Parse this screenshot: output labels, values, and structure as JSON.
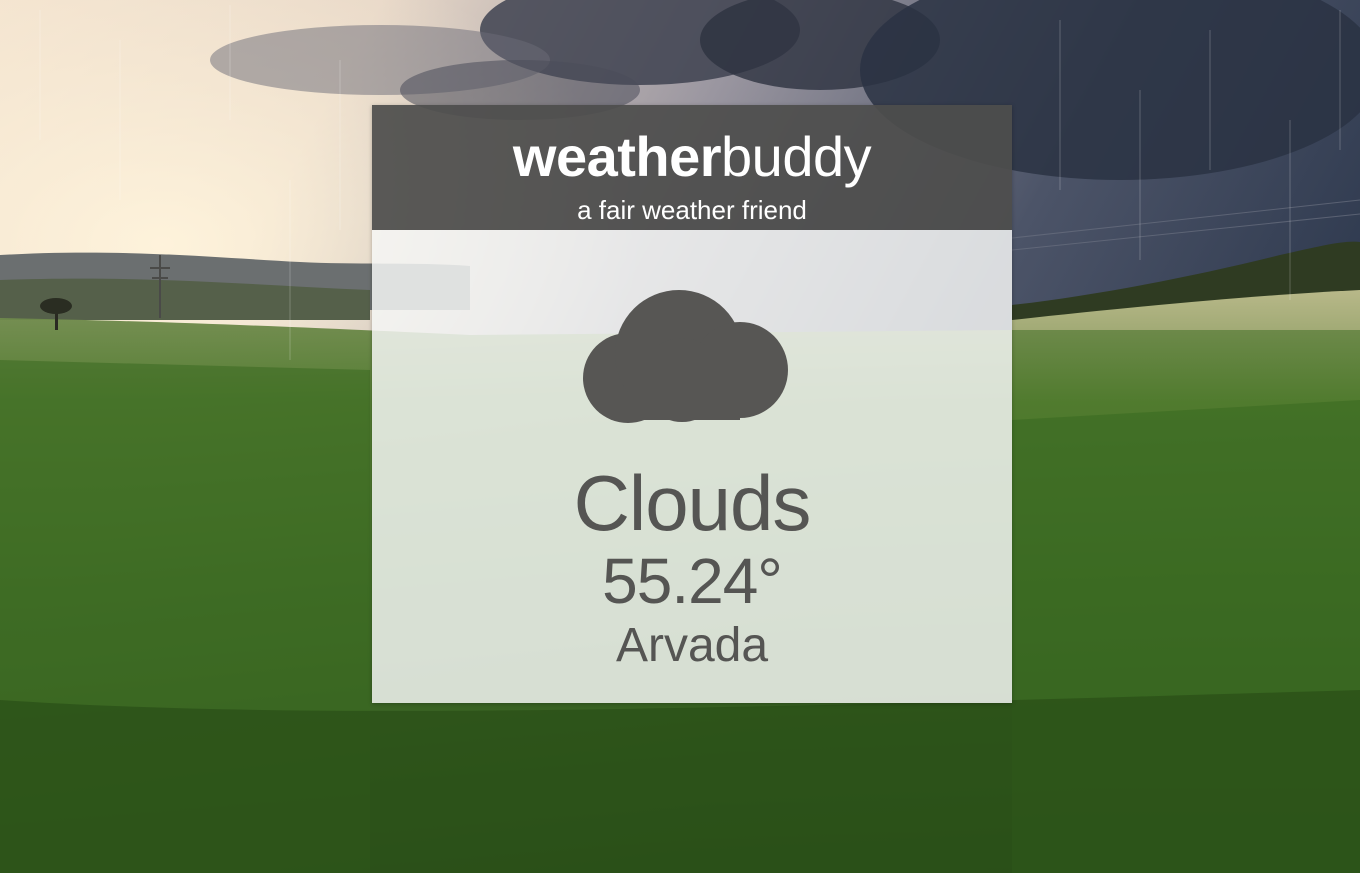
{
  "app": {
    "brand_bold": "weather",
    "brand_light": "buddy",
    "tagline": "a fair weather friend"
  },
  "weather": {
    "condition": "Clouds",
    "temperature": "55.24°",
    "city": "Arvada",
    "icon": "cloud-icon"
  },
  "colors": {
    "header_bg": "#4e4e4c",
    "text_dark": "#555553",
    "icon_fill": "#575654",
    "card_body_bg": "#f6f7f6"
  }
}
